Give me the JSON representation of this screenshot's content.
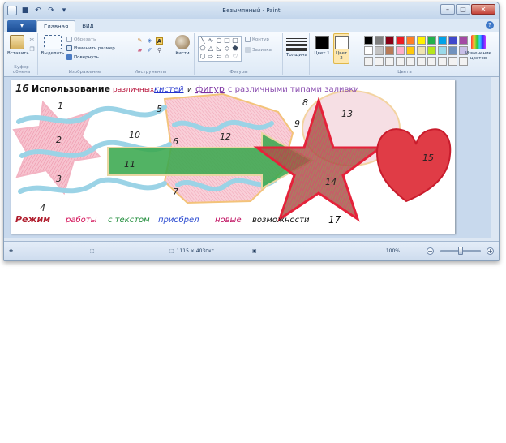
{
  "window": {
    "title": "Безымянный - Paint"
  },
  "tabs": {
    "app_menu": "▾",
    "home": "Главная",
    "view": "Вид"
  },
  "ribbon": {
    "clipboard": {
      "paste": "Вставить",
      "label": "Буфер обмена"
    },
    "image": {
      "select": "Выделить",
      "crop": "Обрезать",
      "resize": "Изменить размер",
      "rotate": "Повернуть",
      "label": "Изображение"
    },
    "tools": {
      "label": "Инструменты"
    },
    "brushes": {
      "label": "Кисти"
    },
    "shapes": {
      "outline": "Контур",
      "fill": "Заливка",
      "label": "Фигуры"
    },
    "size": {
      "label": "Толщина"
    },
    "colors": {
      "color1": "Цвет 1",
      "color2": "Цвет 2",
      "edit": "Изменение цветов",
      "label": "Цвета",
      "color1_value": "#000000",
      "color2_value": "#ffffff",
      "palette": [
        "#000000",
        "#7f7f7f",
        "#880015",
        "#ed1c24",
        "#ff7f27",
        "#fff200",
        "#22b14c",
        "#00a2e8",
        "#3f48cc",
        "#a349a4",
        "#ffffff",
        "#c3c3c3",
        "#b97a57",
        "#ffaec9",
        "#ffc90e",
        "#efe4b0",
        "#b5e61d",
        "#99d9ea",
        "#7092be",
        "#c8bfe7",
        "#f2f2f2",
        "#f2f2f2",
        "#f2f2f2",
        "#f2f2f2",
        "#f2f2f2",
        "#f2f2f2",
        "#f2f2f2",
        "#f2f2f2",
        "#f2f2f2",
        "#f2f2f2"
      ]
    }
  },
  "canvas": {
    "heading_a": "Использование",
    "heading_b": "различных",
    "heading_c": "кистей",
    "heading_d": "и",
    "heading_e": "фигур",
    "heading_f": "с различными типами заливки",
    "footer_a": "Режим",
    "footer_b": "работы",
    "footer_c": "с текстом",
    "footer_d": "приобрел",
    "footer_e": "новые",
    "footer_f": "возможности",
    "numbers": [
      "1",
      "2",
      "3",
      "4",
      "5",
      "6",
      "7",
      "8",
      "9",
      "10",
      "11",
      "12",
      "13",
      "14",
      "15",
      "16",
      "17"
    ]
  },
  "statusbar": {
    "dimensions": "1115 × 403пкс",
    "zoom": "100%",
    "zoom_level": 100
  }
}
